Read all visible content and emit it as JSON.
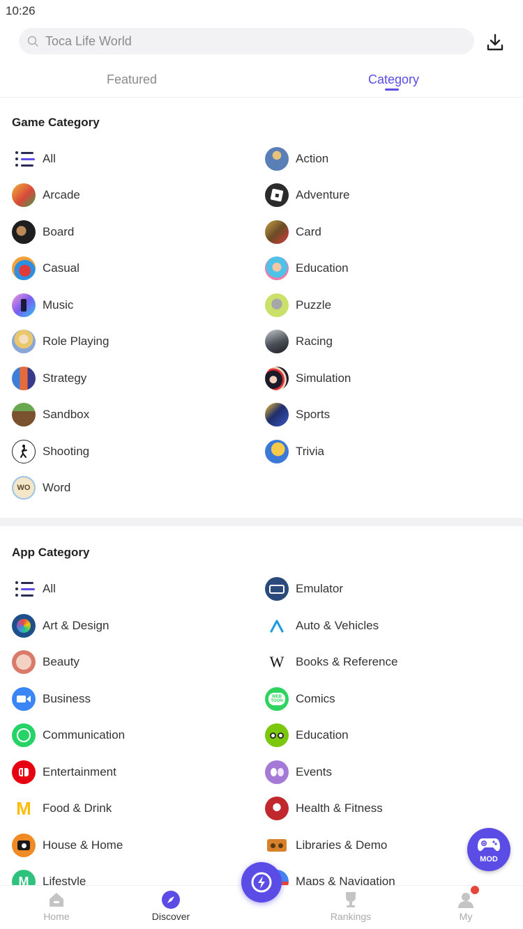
{
  "status_bar": {
    "time": "10:26"
  },
  "search": {
    "placeholder": "Toca Life World"
  },
  "tabs": [
    {
      "label": "Featured",
      "active": false
    },
    {
      "label": "Category",
      "active": true
    }
  ],
  "game_category": {
    "title": "Game Category",
    "items": [
      {
        "label": "All",
        "icon": "list-icon"
      },
      {
        "label": "Action",
        "icon": "action-icon"
      },
      {
        "label": "Arcade",
        "icon": "arcade-icon"
      },
      {
        "label": "Adventure",
        "icon": "adventure-icon"
      },
      {
        "label": "Board",
        "icon": "board-icon"
      },
      {
        "label": "Card",
        "icon": "card-icon"
      },
      {
        "label": "Casual",
        "icon": "casual-icon"
      },
      {
        "label": "Education",
        "icon": "education-icon"
      },
      {
        "label": "Music",
        "icon": "music-icon"
      },
      {
        "label": "Puzzle",
        "icon": "puzzle-icon"
      },
      {
        "label": "Role Playing",
        "icon": "role-playing-icon"
      },
      {
        "label": "Racing",
        "icon": "racing-icon"
      },
      {
        "label": "Strategy",
        "icon": "strategy-icon"
      },
      {
        "label": "Simulation",
        "icon": "simulation-icon"
      },
      {
        "label": "Sandbox",
        "icon": "sandbox-icon"
      },
      {
        "label": "Sports",
        "icon": "sports-icon"
      },
      {
        "label": "Shooting",
        "icon": "shooting-icon"
      },
      {
        "label": "Trivia",
        "icon": "trivia-icon"
      },
      {
        "label": "Word",
        "icon": "word-icon"
      }
    ]
  },
  "app_category": {
    "title": "App Category",
    "items": [
      {
        "label": "All",
        "icon": "list-icon"
      },
      {
        "label": "Emulator",
        "icon": "emulator-icon"
      },
      {
        "label": "Art & Design",
        "icon": "art-design-icon"
      },
      {
        "label": "Auto & Vehicles",
        "icon": "auto-vehicles-icon"
      },
      {
        "label": "Beauty",
        "icon": "beauty-icon"
      },
      {
        "label": "Books & Reference",
        "icon": "books-reference-icon"
      },
      {
        "label": "Business",
        "icon": "business-icon"
      },
      {
        "label": "Comics",
        "icon": "comics-icon"
      },
      {
        "label": "Communication",
        "icon": "communication-icon"
      },
      {
        "label": "Education",
        "icon": "education-icon"
      },
      {
        "label": "Entertainment",
        "icon": "entertainment-icon"
      },
      {
        "label": "Events",
        "icon": "events-icon"
      },
      {
        "label": "Food & Drink",
        "icon": "food-drink-icon"
      },
      {
        "label": "Health & Fitness",
        "icon": "health-fitness-icon"
      },
      {
        "label": "House & Home",
        "icon": "house-home-icon"
      },
      {
        "label": "Libraries & Demo",
        "icon": "libraries-demo-icon"
      },
      {
        "label": "Lifestyle",
        "icon": "lifestyle-icon"
      },
      {
        "label": "Maps & Navigation",
        "icon": "maps-navigation-icon"
      }
    ]
  },
  "mod_button": {
    "label": "MOD"
  },
  "bottom_nav": [
    {
      "label": "Home",
      "icon": "home-icon",
      "active": false
    },
    {
      "label": "Discover",
      "icon": "compass-icon",
      "active": true
    },
    {
      "label": "Rankings",
      "icon": "trophy-icon",
      "active": false
    },
    {
      "label": "My",
      "icon": "user-icon",
      "active": false
    }
  ],
  "colors": {
    "accent": "#5b4ce6",
    "notification": "#e5483a"
  }
}
